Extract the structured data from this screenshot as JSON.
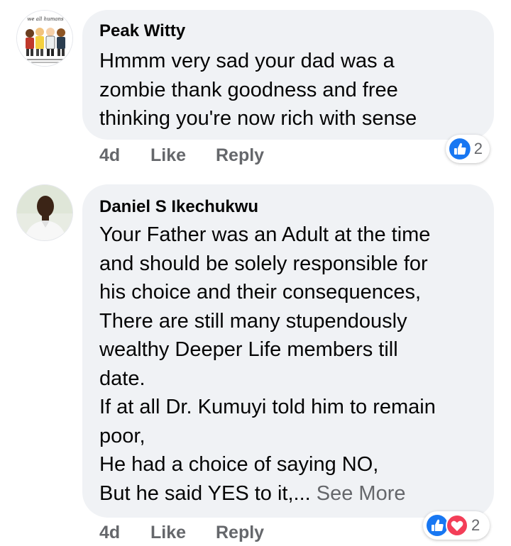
{
  "comments": [
    {
      "author": "Peak Witty",
      "avatar_icon": "group-illustration-avatar",
      "avatar_text": "we all humans",
      "lines": [
        "Hmmm very sad your dad was a",
        "zombie thank goodness and free",
        "thinking you're now rich with sense"
      ],
      "time": "4d",
      "like_label": "Like",
      "reply_label": "Reply",
      "reactions": [
        "like-icon"
      ],
      "reaction_count": "2"
    },
    {
      "author": "Daniel S Ikechukwu",
      "avatar_icon": "profile-photo-avatar",
      "lines": [
        "Your Father was an Adult at the time",
        "and should be solely responsible for",
        "his choice and their consequences,",
        "There are still many stupendously",
        "wealthy Deeper Life members till",
        "date.",
        "If at all Dr. Kumuyi told him to remain",
        "poor,",
        "He had a choice of saying NO,",
        "But he said YES to it,..."
      ],
      "see_more": "See More",
      "time": "4d",
      "like_label": "Like",
      "reply_label": "Reply",
      "reactions": [
        "like-icon",
        "love-icon"
      ],
      "reaction_count": "2"
    }
  ],
  "colors": {
    "bubble_bg": "#f0f2f5",
    "text": "#050505",
    "meta": "#65676b",
    "like_blue": "#1877f2",
    "love_red": "#f33e58"
  }
}
